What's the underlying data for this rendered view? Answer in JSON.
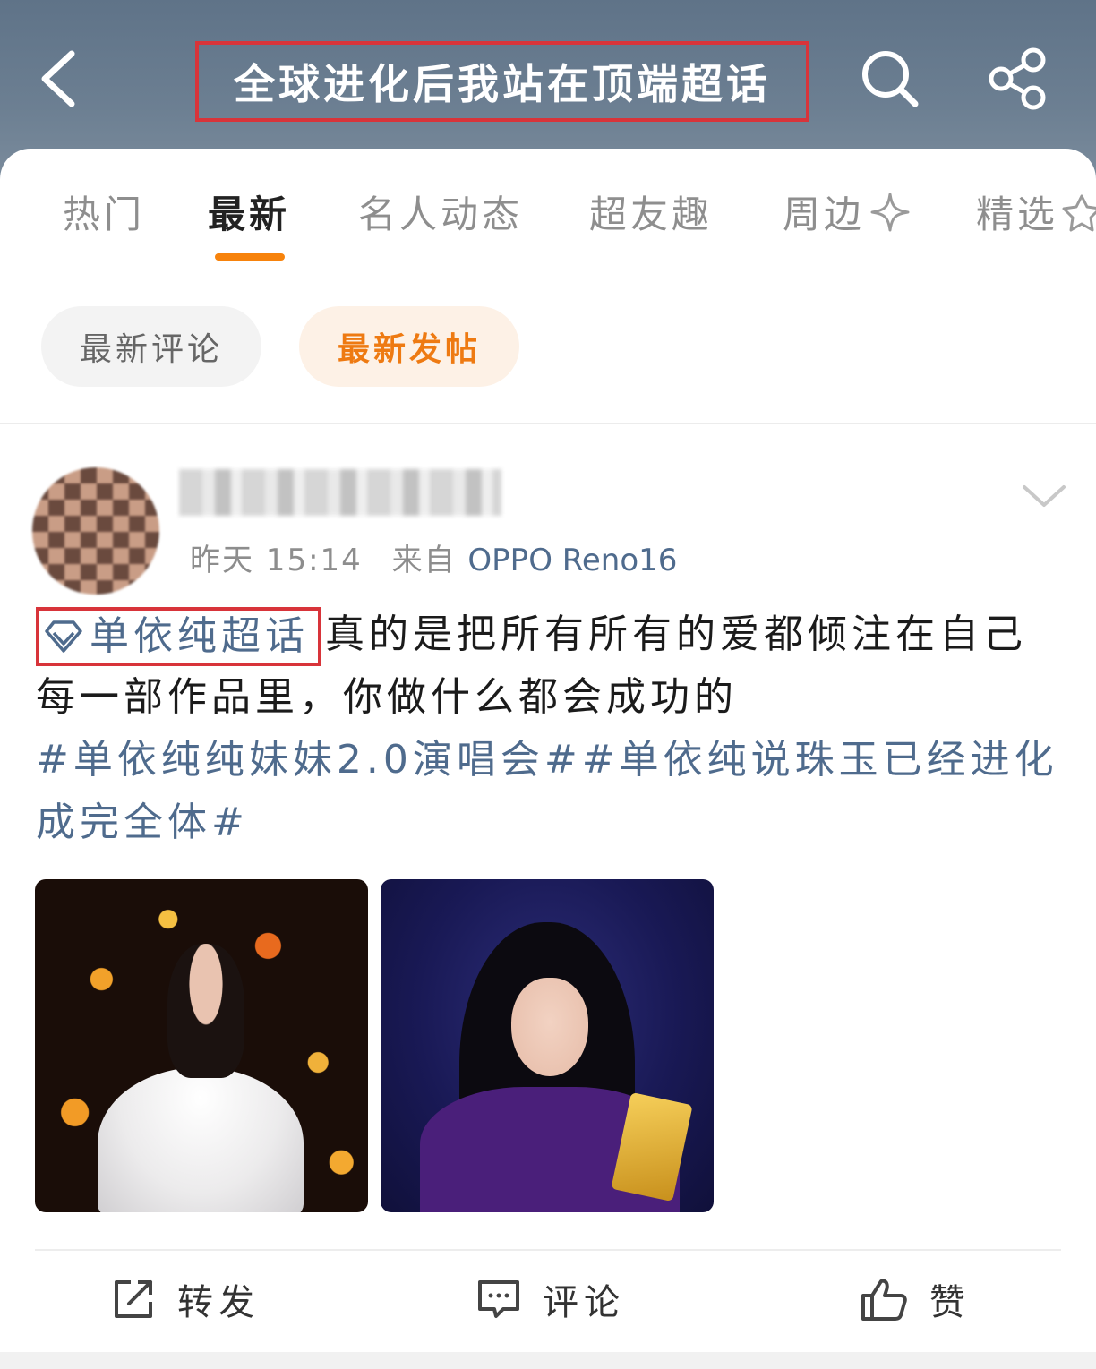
{
  "header": {
    "title": "全球进化后我站在顶端超话",
    "back_icon": "chevron-left-icon",
    "search_icon": "search-icon",
    "share_icon": "share-icon",
    "title_box_color": "#d8343a"
  },
  "tabs": [
    {
      "label": "热门"
    },
    {
      "label": "最新",
      "active": true
    },
    {
      "label": "名人动态"
    },
    {
      "label": "超友趣"
    },
    {
      "label": "周边"
    },
    {
      "label": "精选"
    }
  ],
  "subtabs": [
    {
      "label": "最新评论"
    },
    {
      "label": "最新发帖",
      "active": true
    }
  ],
  "post": {
    "meta_time": "昨天 15:14",
    "meta_from": "来自",
    "meta_source": "OPPO Reno16",
    "topic_tag": "单依纯超话",
    "text_1": "真的是把所有所有的爱都倾注在自己每一部作品里，你做什么都会成功的",
    "hashtag_1": "#单依纯纯妹妹2.0演唱会#",
    "hashtag_2": "#单依纯说珠玉已经进化成完全体#"
  },
  "actions": {
    "repost": "转发",
    "comment": "评论",
    "like": "赞"
  },
  "colors": {
    "accent": "#f7830c",
    "link": "#4f6b8d",
    "highlight_box": "#d8343a"
  }
}
